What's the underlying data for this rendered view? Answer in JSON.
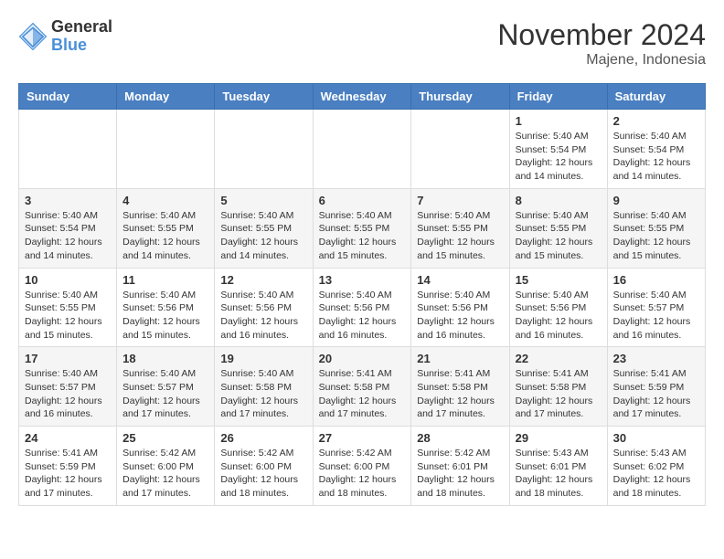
{
  "logo": {
    "general": "General",
    "blue": "Blue"
  },
  "title": {
    "month_year": "November 2024",
    "location": "Majene, Indonesia"
  },
  "days_of_week": [
    "Sunday",
    "Monday",
    "Tuesday",
    "Wednesday",
    "Thursday",
    "Friday",
    "Saturday"
  ],
  "weeks": [
    [
      {
        "day": "",
        "detail": ""
      },
      {
        "day": "",
        "detail": ""
      },
      {
        "day": "",
        "detail": ""
      },
      {
        "day": "",
        "detail": ""
      },
      {
        "day": "",
        "detail": ""
      },
      {
        "day": "1",
        "detail": "Sunrise: 5:40 AM\nSunset: 5:54 PM\nDaylight: 12 hours and 14 minutes."
      },
      {
        "day": "2",
        "detail": "Sunrise: 5:40 AM\nSunset: 5:54 PM\nDaylight: 12 hours and 14 minutes."
      }
    ],
    [
      {
        "day": "3",
        "detail": "Sunrise: 5:40 AM\nSunset: 5:54 PM\nDaylight: 12 hours and 14 minutes."
      },
      {
        "day": "4",
        "detail": "Sunrise: 5:40 AM\nSunset: 5:55 PM\nDaylight: 12 hours and 14 minutes."
      },
      {
        "day": "5",
        "detail": "Sunrise: 5:40 AM\nSunset: 5:55 PM\nDaylight: 12 hours and 14 minutes."
      },
      {
        "day": "6",
        "detail": "Sunrise: 5:40 AM\nSunset: 5:55 PM\nDaylight: 12 hours and 15 minutes."
      },
      {
        "day": "7",
        "detail": "Sunrise: 5:40 AM\nSunset: 5:55 PM\nDaylight: 12 hours and 15 minutes."
      },
      {
        "day": "8",
        "detail": "Sunrise: 5:40 AM\nSunset: 5:55 PM\nDaylight: 12 hours and 15 minutes."
      },
      {
        "day": "9",
        "detail": "Sunrise: 5:40 AM\nSunset: 5:55 PM\nDaylight: 12 hours and 15 minutes."
      }
    ],
    [
      {
        "day": "10",
        "detail": "Sunrise: 5:40 AM\nSunset: 5:55 PM\nDaylight: 12 hours and 15 minutes."
      },
      {
        "day": "11",
        "detail": "Sunrise: 5:40 AM\nSunset: 5:56 PM\nDaylight: 12 hours and 15 minutes."
      },
      {
        "day": "12",
        "detail": "Sunrise: 5:40 AM\nSunset: 5:56 PM\nDaylight: 12 hours and 16 minutes."
      },
      {
        "day": "13",
        "detail": "Sunrise: 5:40 AM\nSunset: 5:56 PM\nDaylight: 12 hours and 16 minutes."
      },
      {
        "day": "14",
        "detail": "Sunrise: 5:40 AM\nSunset: 5:56 PM\nDaylight: 12 hours and 16 minutes."
      },
      {
        "day": "15",
        "detail": "Sunrise: 5:40 AM\nSunset: 5:56 PM\nDaylight: 12 hours and 16 minutes."
      },
      {
        "day": "16",
        "detail": "Sunrise: 5:40 AM\nSunset: 5:57 PM\nDaylight: 12 hours and 16 minutes."
      }
    ],
    [
      {
        "day": "17",
        "detail": "Sunrise: 5:40 AM\nSunset: 5:57 PM\nDaylight: 12 hours and 16 minutes."
      },
      {
        "day": "18",
        "detail": "Sunrise: 5:40 AM\nSunset: 5:57 PM\nDaylight: 12 hours and 17 minutes."
      },
      {
        "day": "19",
        "detail": "Sunrise: 5:40 AM\nSunset: 5:58 PM\nDaylight: 12 hours and 17 minutes."
      },
      {
        "day": "20",
        "detail": "Sunrise: 5:41 AM\nSunset: 5:58 PM\nDaylight: 12 hours and 17 minutes."
      },
      {
        "day": "21",
        "detail": "Sunrise: 5:41 AM\nSunset: 5:58 PM\nDaylight: 12 hours and 17 minutes."
      },
      {
        "day": "22",
        "detail": "Sunrise: 5:41 AM\nSunset: 5:58 PM\nDaylight: 12 hours and 17 minutes."
      },
      {
        "day": "23",
        "detail": "Sunrise: 5:41 AM\nSunset: 5:59 PM\nDaylight: 12 hours and 17 minutes."
      }
    ],
    [
      {
        "day": "24",
        "detail": "Sunrise: 5:41 AM\nSunset: 5:59 PM\nDaylight: 12 hours and 17 minutes."
      },
      {
        "day": "25",
        "detail": "Sunrise: 5:42 AM\nSunset: 6:00 PM\nDaylight: 12 hours and 17 minutes."
      },
      {
        "day": "26",
        "detail": "Sunrise: 5:42 AM\nSunset: 6:00 PM\nDaylight: 12 hours and 18 minutes."
      },
      {
        "day": "27",
        "detail": "Sunrise: 5:42 AM\nSunset: 6:00 PM\nDaylight: 12 hours and 18 minutes."
      },
      {
        "day": "28",
        "detail": "Sunrise: 5:42 AM\nSunset: 6:01 PM\nDaylight: 12 hours and 18 minutes."
      },
      {
        "day": "29",
        "detail": "Sunrise: 5:43 AM\nSunset: 6:01 PM\nDaylight: 12 hours and 18 minutes."
      },
      {
        "day": "30",
        "detail": "Sunrise: 5:43 AM\nSunset: 6:02 PM\nDaylight: 12 hours and 18 minutes."
      }
    ]
  ]
}
